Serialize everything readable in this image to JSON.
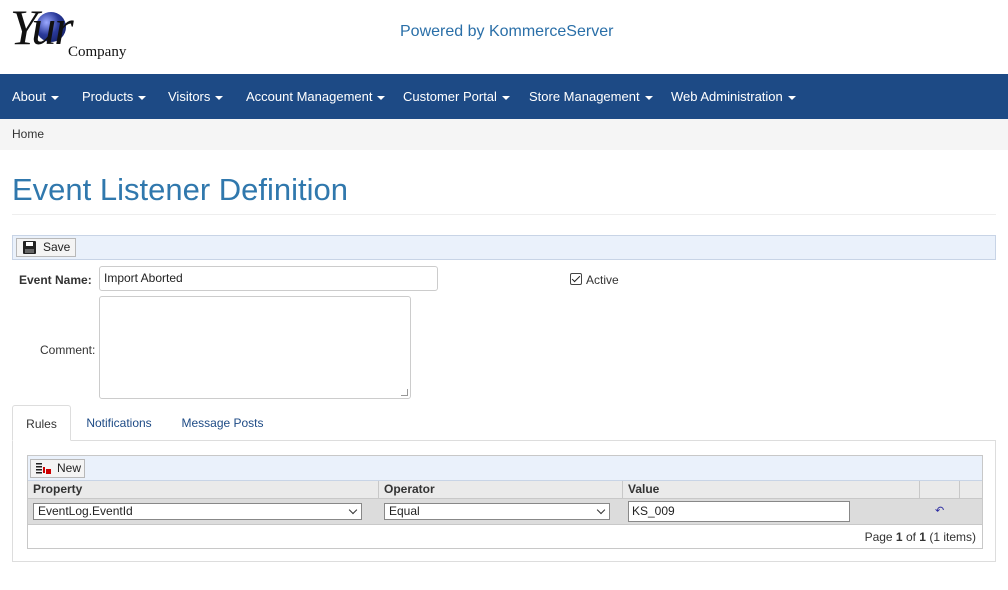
{
  "header": {
    "logo_word": "Yur",
    "logo_company": "Company",
    "powered_by": "Powered by KommerceServer"
  },
  "nav": {
    "items": [
      {
        "label": "About"
      },
      {
        "label": "Products"
      },
      {
        "label": "Visitors"
      },
      {
        "label": "Account Management"
      },
      {
        "label": "Customer Portal"
      },
      {
        "label": "Store Management"
      },
      {
        "label": "Web Administration"
      }
    ]
  },
  "breadcrumb": "Home",
  "page_title": "Event Listener Definition",
  "toolbar": {
    "save_label": "Save"
  },
  "form": {
    "event_name_label": "Event Name:",
    "event_name_value": "Import Aborted",
    "active_label": "Active",
    "active_checked": true,
    "comment_label": "Comment:",
    "comment_value": ""
  },
  "tabs": [
    {
      "label": "Rules",
      "active": true
    },
    {
      "label": "Notifications",
      "active": false
    },
    {
      "label": "Message Posts",
      "active": false
    }
  ],
  "grid": {
    "new_label": "New",
    "columns": [
      "Property",
      "Operator",
      "Value"
    ],
    "rows": [
      {
        "property": "EventLog.EventId",
        "operator": "Equal",
        "value": "KS_009"
      }
    ],
    "pager": {
      "prefix": "Page ",
      "page": "1",
      "of": " of ",
      "total": "1",
      "items": " (1 items)"
    }
  },
  "icons": {
    "save": "floppy-disk-icon",
    "new": "new-rule-icon",
    "undo": "undo-icon"
  },
  "colors": {
    "nav_bg": "#1d4a85",
    "title": "#3078ad",
    "link": "#1d4a85"
  }
}
